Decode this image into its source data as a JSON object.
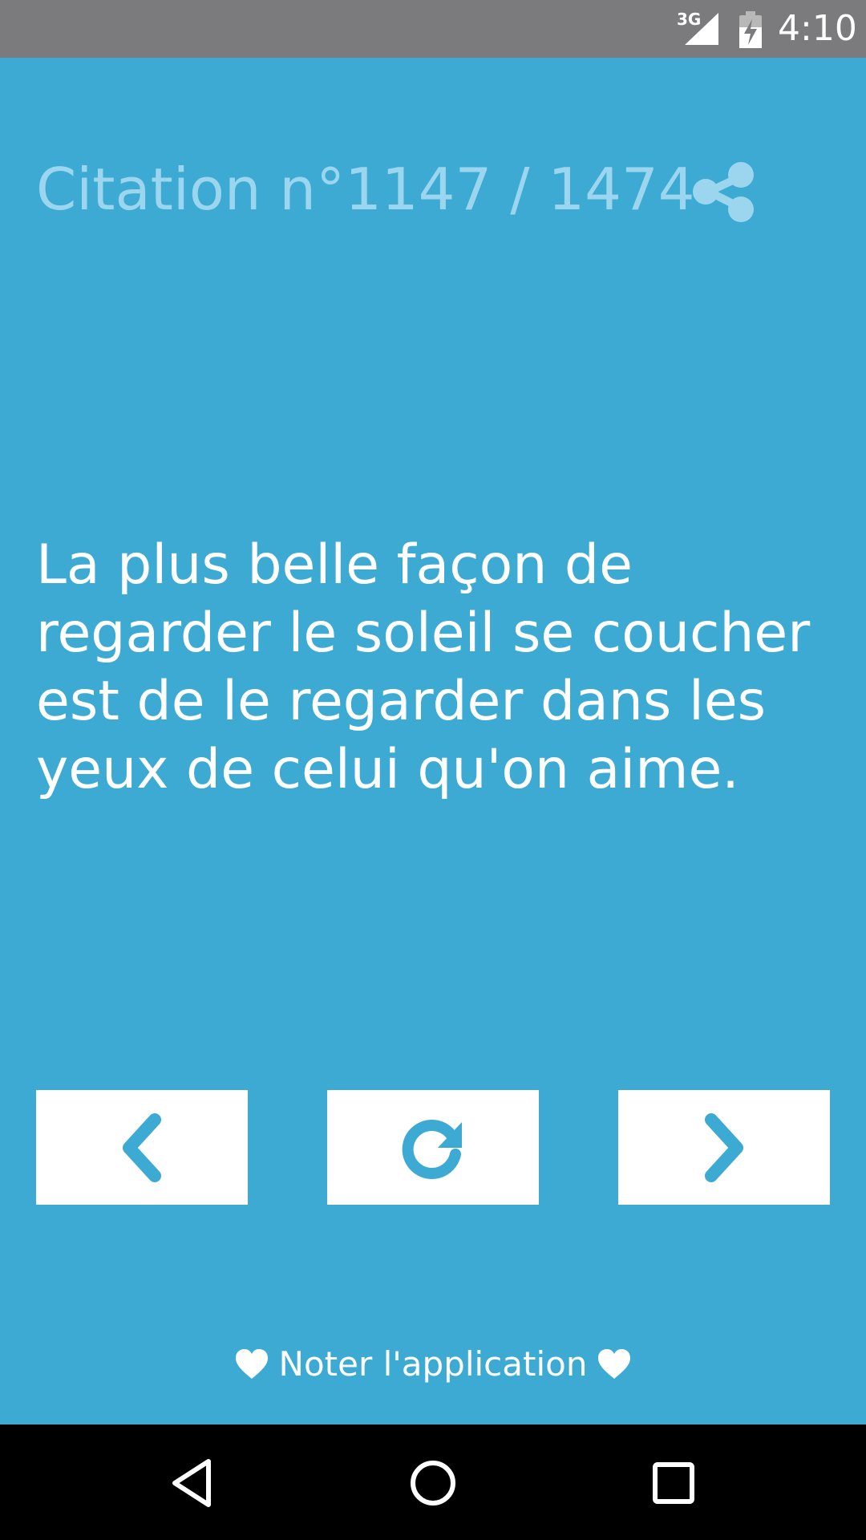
{
  "status_bar": {
    "network": "3G",
    "time": "4:10"
  },
  "header": {
    "counter": "Citation n°1147 / 1474",
    "share_icon": "share-icon"
  },
  "quote": {
    "text": "La plus belle façon de regarder le soleil se coucher est de le regarder dans les yeux de celui qu'on aime."
  },
  "controls": {
    "previous_icon": "chevron-left-icon",
    "random_icon": "refresh-icon",
    "next_icon": "chevron-right-icon"
  },
  "footer": {
    "rate_label": "Noter l'application",
    "rate_icon": "heart-icon"
  },
  "system_nav": {
    "back_icon": "back-triangle-icon",
    "home_icon": "home-circle-icon",
    "recents_icon": "recents-square-icon"
  },
  "colors": {
    "background": "#3DAAD4",
    "counter_text": "#9BD6EE",
    "status_bar": "#7B7A7C",
    "button": "#FFFFFF",
    "accent": "#3DAAD4"
  }
}
